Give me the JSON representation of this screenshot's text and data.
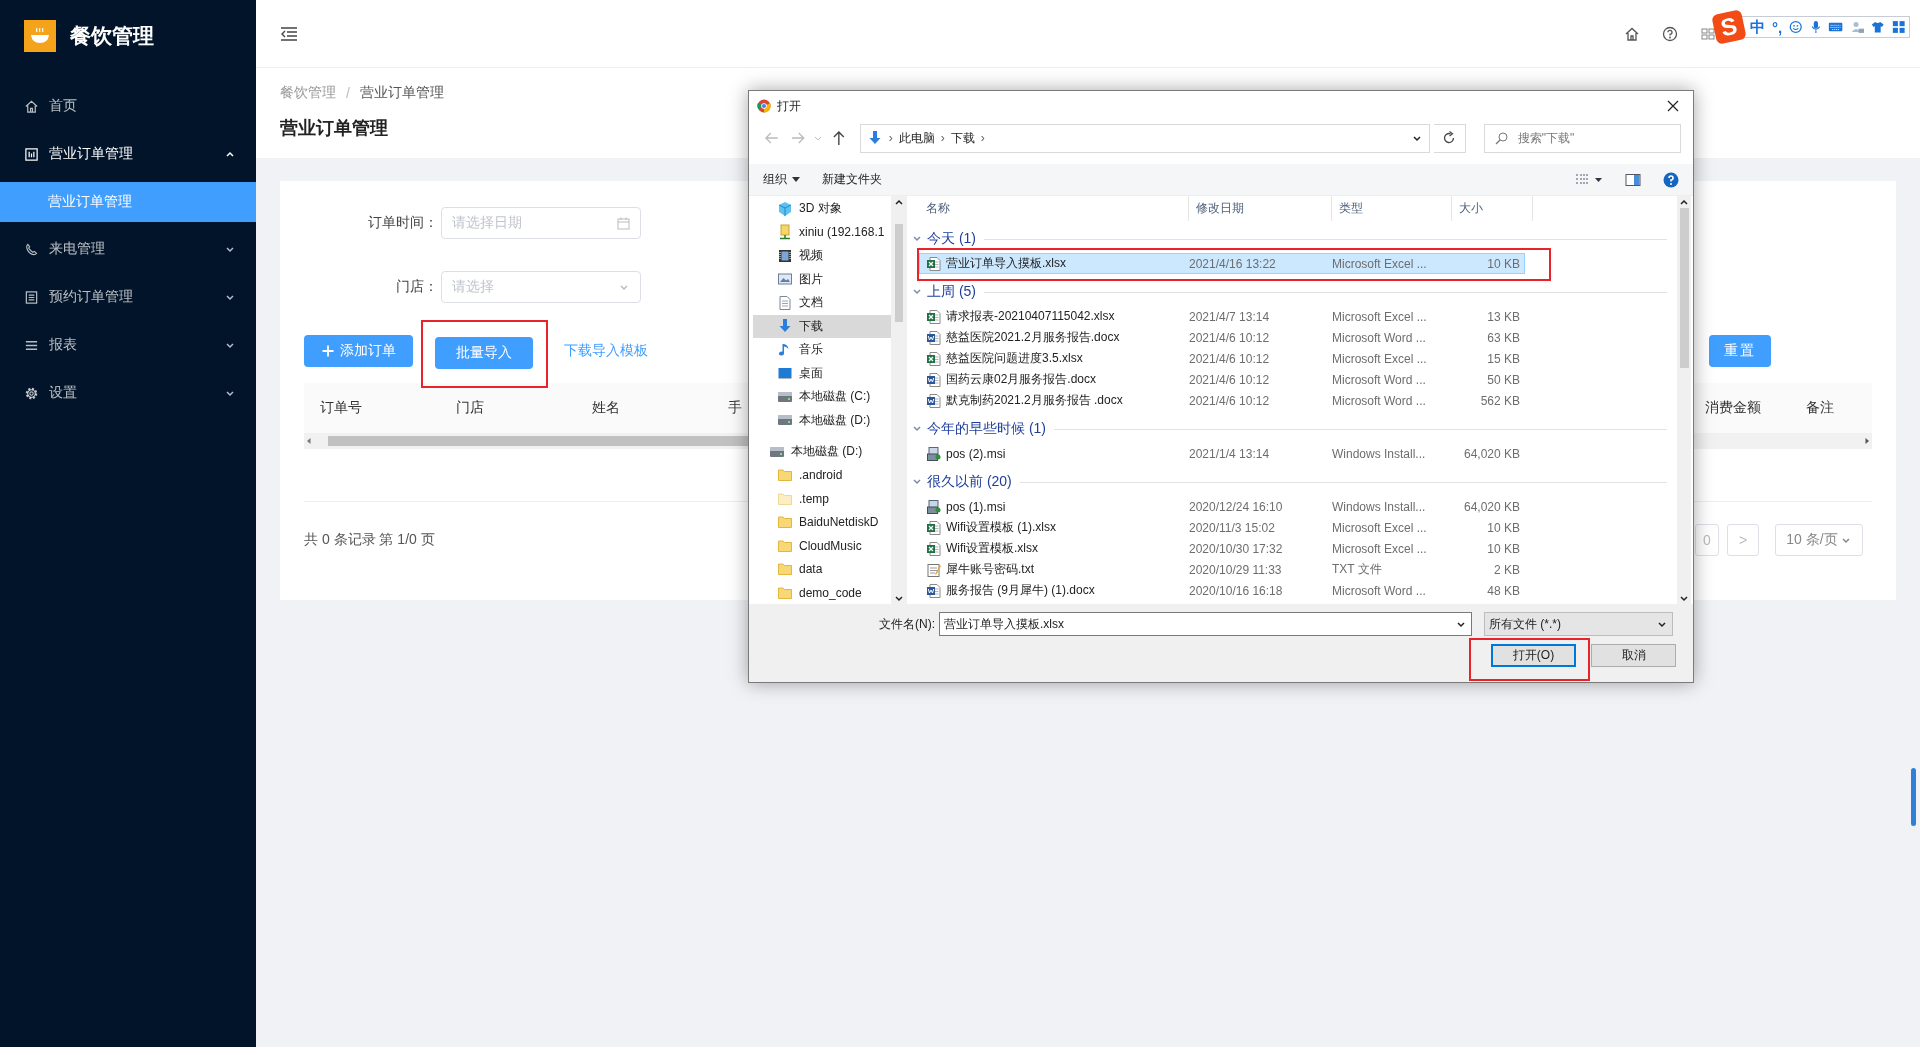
{
  "sidebar": {
    "logo_text": "餐饮管理",
    "items": [
      {
        "kind": "link",
        "label": "首页"
      },
      {
        "kind": "submenu",
        "label": "营业订单管理",
        "expanded": true,
        "children": [
          {
            "label": "营业订单管理",
            "selected": true
          }
        ]
      },
      {
        "kind": "submenu",
        "label": "来电管理",
        "expanded": false
      },
      {
        "kind": "submenu",
        "label": "预约订单管理",
        "expanded": false
      },
      {
        "kind": "submenu",
        "label": "报表",
        "expanded": false
      },
      {
        "kind": "submenu",
        "label": "设置",
        "expanded": false
      }
    ]
  },
  "breadcrumb": [
    "餐饮管理",
    "营业订单管理"
  ],
  "breadcrumb_separator": "/",
  "page_title": "营业订单管理",
  "filters": [
    {
      "kind": "date",
      "label": "订单时间：",
      "placeholder": "请选择日期"
    },
    {
      "kind": "select",
      "label": "门店：",
      "placeholder": "请选择"
    }
  ],
  "actions": {
    "add_button": "添加订单",
    "import_button": "批量导入",
    "template_link": "下载导入模板",
    "reset_button": "重置"
  },
  "table": {
    "left_columns": [
      "订单号",
      "门店",
      "姓名",
      "手"
    ],
    "right_columns": [
      "消费金额",
      "备注"
    ]
  },
  "pagination": {
    "summary": "共 0 条记录 第 1/0 页",
    "page": "0",
    "next": ">",
    "page_size": "10 条/页"
  },
  "ime_toolbar": {
    "logo": "S",
    "mode": "中",
    "punctuation": "°,"
  },
  "dialog": {
    "title": "打开",
    "path": [
      "此电脑",
      "下载"
    ],
    "path_separator": "›",
    "search_placeholder": "搜索\"下载\"",
    "toolbar": [
      {
        "kind": "menu",
        "label": "组织"
      },
      {
        "kind": "button",
        "label": "新建文件夹"
      }
    ],
    "nav": {
      "locations": [
        {
          "kind": "objects",
          "label": "3D 对象",
          "selected": false
        },
        {
          "kind": "network",
          "label": "xiniu (192.168.1",
          "selected": false
        },
        {
          "kind": "video",
          "label": "视频",
          "selected": false
        },
        {
          "kind": "pictures",
          "label": "图片",
          "selected": false
        },
        {
          "kind": "documents",
          "label": "文档",
          "selected": false
        },
        {
          "kind": "downloads",
          "label": "下载",
          "selected": true
        },
        {
          "kind": "music",
          "label": "音乐",
          "selected": false
        },
        {
          "kind": "desktop",
          "label": "桌面",
          "selected": false
        },
        {
          "kind": "disk",
          "label": "本地磁盘 (C:)",
          "selected": false
        },
        {
          "kind": "disk",
          "label": "本地磁盘 (D:)",
          "selected": false
        }
      ],
      "drives": [
        {
          "kind": "disk",
          "label": "本地磁盘 (D:)",
          "selected": false,
          "children": [
            {
              "kind": "folder",
              "label": ".android",
              "selected": false
            },
            {
              "kind": "folder-light",
              "label": ".temp",
              "selected": false
            },
            {
              "kind": "folder",
              "label": "BaiduNetdiskD",
              "selected": false
            },
            {
              "kind": "folder",
              "label": "CloudMusic",
              "selected": false
            },
            {
              "kind": "folder",
              "label": "data",
              "selected": false
            },
            {
              "kind": "folder",
              "label": "demo_code",
              "selected": false
            }
          ]
        }
      ]
    },
    "columns": [
      "名称",
      "修改日期",
      "类型",
      "大小"
    ],
    "groups": [
      {
        "title": "今天 (1)",
        "expanded": true,
        "files": [
          {
            "kind": "excel",
            "name": "营业订单导入摸板.xlsx",
            "date": "2021/4/16 13:22",
            "type": "Microsoft Excel ...",
            "size": "10 KB",
            "selected": true
          }
        ]
      },
      {
        "title": "上周 (5)",
        "expanded": true,
        "files": [
          {
            "kind": "excel",
            "name": "请求报表-20210407115042.xlsx",
            "date": "2021/4/7 13:14",
            "type": "Microsoft Excel ...",
            "size": "13 KB",
            "selected": false
          },
          {
            "kind": "word",
            "name": "慈益医院2021.2月服务报告.docx",
            "date": "2021/4/6 10:12",
            "type": "Microsoft Word ...",
            "size": "63 KB",
            "selected": false
          },
          {
            "kind": "excel",
            "name": "慈益医院问题进度3.5.xlsx",
            "date": "2021/4/6 10:12",
            "type": "Microsoft Excel ...",
            "size": "15 KB",
            "selected": false
          },
          {
            "kind": "word",
            "name": "国药云康02月服务报告.docx",
            "date": "2021/4/6 10:12",
            "type": "Microsoft Word ...",
            "size": "50 KB",
            "selected": false
          },
          {
            "kind": "word",
            "name": "默克制药2021.2月服务报告 .docx",
            "date": "2021/4/6 10:12",
            "type": "Microsoft Word ...",
            "size": "562 KB",
            "selected": false
          }
        ]
      },
      {
        "title": "今年的早些时候 (1)",
        "expanded": true,
        "files": [
          {
            "kind": "msi",
            "name": "pos (2).msi",
            "date": "2021/1/4 13:14",
            "type": "Windows Install...",
            "size": "64,020 KB",
            "selected": false
          }
        ]
      },
      {
        "title": "很久以前 (20)",
        "expanded": true,
        "files": [
          {
            "kind": "msi",
            "name": "pos (1).msi",
            "date": "2020/12/24 16:10",
            "type": "Windows Install...",
            "size": "64,020 KB",
            "selected": false
          },
          {
            "kind": "excel",
            "name": "Wifi设置模板 (1).xlsx",
            "date": "2020/11/3 15:02",
            "type": "Microsoft Excel ...",
            "size": "10 KB",
            "selected": false
          },
          {
            "kind": "excel",
            "name": "Wifi设置模板.xlsx",
            "date": "2020/10/30 17:32",
            "type": "Microsoft Excel ...",
            "size": "10 KB",
            "selected": false
          },
          {
            "kind": "txt",
            "name": "犀牛账号密码.txt",
            "date": "2020/10/29 11:33",
            "type": "TXT 文件",
            "size": "2 KB",
            "selected": false
          },
          {
            "kind": "word",
            "name": "服务报告 (9月犀牛) (1).docx",
            "date": "2020/10/16 16:18",
            "type": "Microsoft Word ...",
            "size": "48 KB",
            "selected": false
          }
        ]
      }
    ],
    "filename_label": "文件名(N):",
    "filename": "营业订单导入摸板.xlsx",
    "file_type": "所有文件 (*.*)",
    "buttons": [
      {
        "kind": "default",
        "label": "打开(O)"
      },
      {
        "kind": "normal",
        "label": "取消"
      }
    ]
  }
}
